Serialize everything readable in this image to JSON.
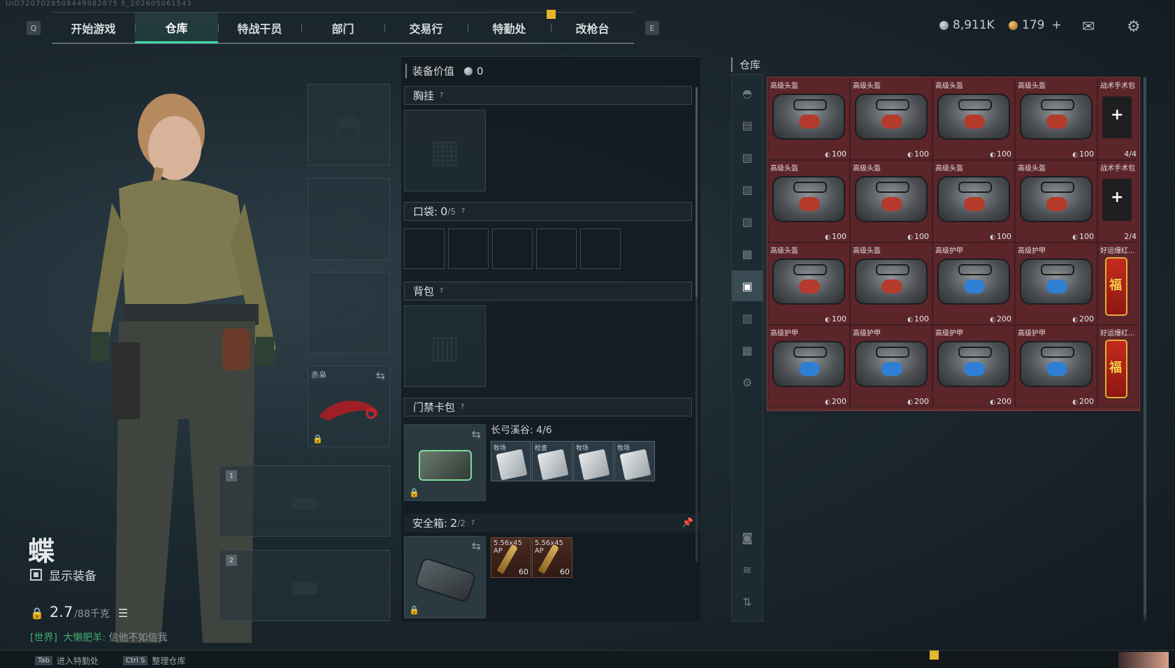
{
  "uid": "UID7207028508449982875 5_202605061543",
  "nav": {
    "left_key": "Q",
    "right_key": "E",
    "tabs": [
      {
        "label": "开始游戏"
      },
      {
        "label": "仓库"
      },
      {
        "label": "特战干员"
      },
      {
        "label": "部门"
      },
      {
        "label": "交易行"
      },
      {
        "label": "特勤处"
      },
      {
        "label": "改枪台"
      }
    ],
    "active_tab_index": 1
  },
  "currency": {
    "silver": "8,911K",
    "gold": "179",
    "add": "+"
  },
  "top_icons": {
    "mail": "mail-icon",
    "settings": "gear-icon"
  },
  "character": {
    "name": "蝶",
    "show_equipment_label": "显示装备",
    "weight_current": "2.7",
    "weight_max": "/88千克"
  },
  "chat": {
    "channel": "[世界]",
    "sender": "大懒肥羊:",
    "message": "信他不如信我"
  },
  "loadout": {
    "knife_label": "赤枭",
    "weapon_slot_1": "1",
    "weapon_slot_2": "2"
  },
  "equipment": {
    "value_label": "装备价值",
    "value": "0",
    "chest_rig": "胸挂",
    "pocket_label": "口袋:",
    "pocket_count": "0",
    "pocket_max": "/5",
    "backpack": "背包",
    "keycard_label": "门禁卡包",
    "keycard_map": "长弓溪谷: 4/6",
    "keycards": [
      "牧场",
      "检查",
      "牧场",
      "牧场"
    ],
    "safebox_label": "安全箱:",
    "safebox_count": "2",
    "safebox_max": "/2",
    "ammo": [
      {
        "name": "5.56x45 AP",
        "qty": "60"
      },
      {
        "name": "5.56x45 AP",
        "qty": "60"
      }
    ],
    "help_mark": "?"
  },
  "warehouse": {
    "title": "仓库",
    "items": [
      {
        "name": "高级头盔",
        "type": "helmet",
        "value": "100"
      },
      {
        "name": "高级头盔",
        "type": "helmet",
        "value": "100"
      },
      {
        "name": "高级头盔",
        "type": "helmet",
        "value": "100"
      },
      {
        "name": "高级头盔",
        "type": "helmet",
        "value": "100"
      },
      {
        "name": "战术手术包",
        "type": "med",
        "count": "4/4"
      },
      {
        "name": "高级头盔",
        "type": "helmet",
        "value": "100"
      },
      {
        "name": "高级头盔",
        "type": "helmet",
        "value": "100"
      },
      {
        "name": "高级头盔",
        "type": "helmet",
        "value": "100"
      },
      {
        "name": "高级头盔",
        "type": "helmet",
        "value": "100"
      },
      {
        "name": "战术手术包",
        "type": "med",
        "count": "2/4"
      },
      {
        "name": "高级头盔",
        "type": "helmet",
        "value": "100"
      },
      {
        "name": "高级头盔",
        "type": "helmet",
        "value": "100"
      },
      {
        "name": "高级护甲",
        "type": "armor",
        "value": "200"
      },
      {
        "name": "高级护甲",
        "type": "armor",
        "value": "200"
      },
      {
        "name": "好运爆红...",
        "type": "firecracker"
      },
      {
        "name": "高级护甲",
        "type": "armor",
        "value": "200"
      },
      {
        "name": "高级护甲",
        "type": "armor",
        "value": "200"
      },
      {
        "name": "高级护甲",
        "type": "armor",
        "value": "200"
      },
      {
        "name": "高级护甲",
        "type": "armor",
        "value": "200"
      },
      {
        "name": "好运爆红...",
        "type": "firecracker"
      }
    ]
  },
  "bottom": {
    "btn1_key": "Tab",
    "btn1_label": "进入特勤处",
    "btn2_key": "Ctrl S",
    "btn2_label": "整理仓库"
  }
}
